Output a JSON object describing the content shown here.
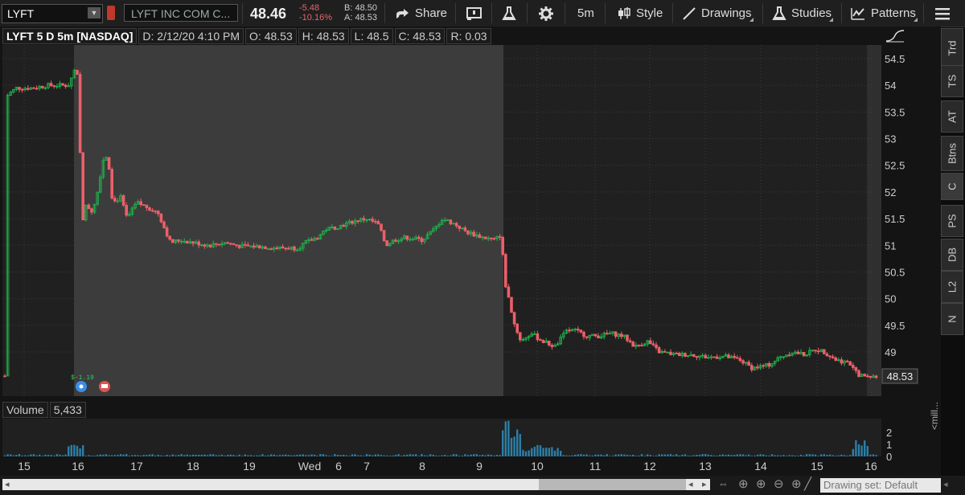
{
  "toolbar": {
    "symbol": "LYFT",
    "company": "LYFT INC COM C...",
    "last": "48.46",
    "change": "-5.48",
    "change_pct": "-10.16%",
    "bid": "B: 48.50",
    "ask": "A: 48.53",
    "share": "Share",
    "interval": "5m",
    "style": "Style",
    "drawings": "Drawings",
    "studies": "Studies",
    "patterns": "Patterns"
  },
  "info": {
    "title": "LYFT 5 D 5m [NASDAQ]",
    "date": "D: 2/12/20 4:10 PM",
    "open": "O: 48.53",
    "high": "H: 48.53",
    "low": "L: 48.5",
    "close": "C: 48.53",
    "range": "R: 0.03"
  },
  "right_tabs": [
    "Trd",
    "TS",
    "AT",
    "Btns",
    "C",
    "PS",
    "DB",
    "L2",
    "N"
  ],
  "volume": {
    "label": "Volume",
    "value": "5,433",
    "axis_unit": "<mill..."
  },
  "drawing_set": "Drawing set: Default",
  "chart_data": {
    "type": "candlestick",
    "price_axis_ticks": [
      "54.5",
      "54",
      "53.5",
      "53",
      "52.5",
      "52",
      "51.5",
      "51",
      "50.5",
      "50",
      "49.5",
      "49"
    ],
    "last_price_label": "48.53",
    "x_ticks": [
      "15",
      "16",
      "17",
      "18",
      "19",
      "Wed",
      "6",
      "7",
      "8",
      "9",
      "10",
      "11",
      "12",
      "13",
      "14",
      "15",
      "16"
    ],
    "volume_ticks": [
      "2",
      "1",
      "0"
    ],
    "annotation": "$-1.19",
    "colors": {
      "up": "#1fb34b",
      "down": "#ec5f6a",
      "session_bg": "#3c3c3c",
      "volume": "#2b7fa8"
    },
    "ylim": [
      48.4,
      54.9
    ]
  }
}
